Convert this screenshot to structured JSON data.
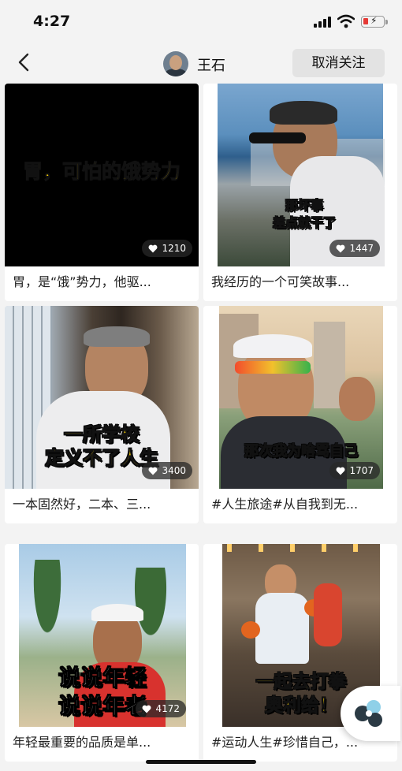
{
  "status_bar": {
    "time": "4:27"
  },
  "header": {
    "user_name": "王石",
    "unfollow_label": "取消关注"
  },
  "videos": [
    {
      "caption": "胃，是“饿”势力，他驱...",
      "likes": "1210",
      "overlay": [
        "胃，可怕的饿势力"
      ]
    },
    {
      "caption": "我经历的一个可笑故事...",
      "likes": "1447",
      "overlay": [
        "那坏事",
        "差点就干了"
      ]
    },
    {
      "caption": "一本固然好，二本、三...",
      "likes": "3400",
      "overlay": [
        "一所学校",
        "定义不了人生"
      ]
    },
    {
      "caption": "#人生旅途#从自我到无...",
      "likes": "1707",
      "overlay": [
        "那次我为啥骂自己"
      ]
    },
    {
      "caption": "年轻最重要的品质是单...",
      "likes": "4172",
      "overlay": [
        "说说年轻",
        "说说年老"
      ]
    },
    {
      "caption": "#运动人生#珍惜自己，...",
      "likes": "",
      "overlay": [
        "一起去打拳",
        "奥利给！"
      ]
    }
  ],
  "icons": {
    "back": "chevron-left-icon",
    "like": "heart-icon",
    "signal": "cellular-signal-icon",
    "wifi": "wifi-icon",
    "battery": "battery-low-charging-icon"
  },
  "colors": {
    "overlay_text": "#ffd400",
    "battery_low": "#e53935",
    "page_background": "#f3f3f3"
  }
}
